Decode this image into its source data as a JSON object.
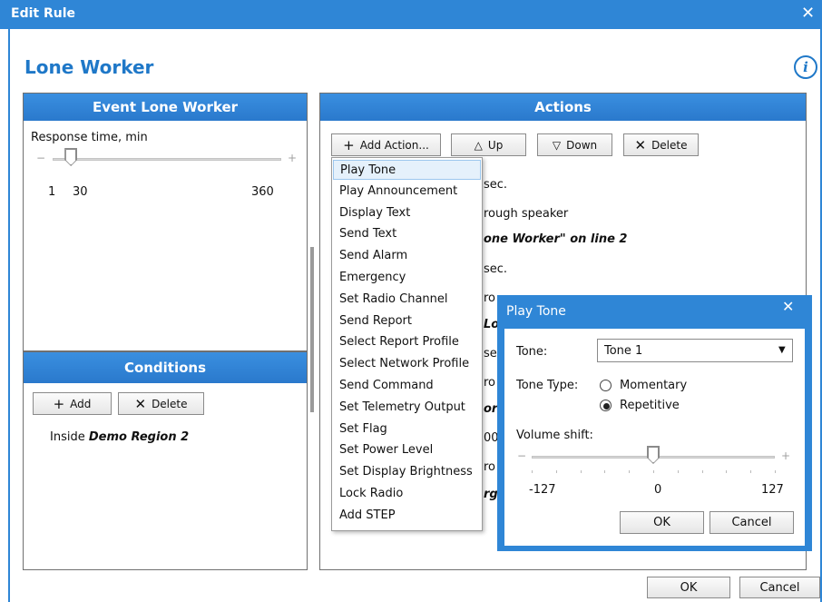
{
  "window": {
    "title": "Edit Rule",
    "close_glyph": "✕"
  },
  "rule": {
    "title": "Lone Worker",
    "info_glyph": "i"
  },
  "event_panel": {
    "header": "Event  Lone Worker",
    "label": "Response time, min",
    "min": "1",
    "value": "30",
    "max": "360",
    "minus": "−",
    "plus": "+",
    "level_fraction": 0.08
  },
  "conditions_panel": {
    "header": "Conditions",
    "add_label": "Add",
    "delete_label": "Delete",
    "item_prefix": "Inside ",
    "item_region": "Demo Region 2"
  },
  "actions_panel": {
    "header": "Actions",
    "add_action_label": "Add Action...",
    "up_label": "Up",
    "down_label": "Down",
    "delete_label": "Delete",
    "visible_fragments": [
      "sec.",
      "rough speaker",
      "one Worker\" on line 2",
      "sec.",
      "ro",
      "Lo",
      "se",
      "ro",
      "ork",
      "00",
      "ro",
      "rg"
    ]
  },
  "add_action_menu": {
    "items": [
      "Play Tone",
      "Play Announcement",
      "Display Text",
      "Send Text",
      "Send Alarm",
      "Emergency",
      "Set Radio Channel",
      "Send Report",
      "Select Report Profile",
      "Select Network Profile",
      "Send Command",
      "Set Telemetry Output",
      "Set Flag",
      "Set Power Level",
      "Set Display Brightness",
      "Lock Radio",
      "Add STEP"
    ],
    "selected_index": 0
  },
  "play_tone": {
    "title": "Play Tone",
    "close_glyph": "✕",
    "tone_label": "Tone:",
    "tone_value": "Tone 1",
    "tone_type_label": "Tone Type:",
    "momentary_label": "Momentary",
    "repetitive_label": "Repetitive",
    "selected_type": "Repetitive",
    "volume_label": "Volume shift:",
    "min": "-127",
    "value": "0",
    "max": "127",
    "minus": "−",
    "plus": "+",
    "level_fraction": 0.5,
    "ok_label": "OK",
    "cancel_label": "Cancel"
  },
  "footer": {
    "ok_label": "OK",
    "cancel_label": "Cancel"
  },
  "icons": {
    "add": "+",
    "up": "△",
    "down": "▽",
    "delete": "✕",
    "dropdown": "▼"
  },
  "colors": {
    "accent": "#2f86d6",
    "header_blue": "#3a8fe0",
    "selection": "#e5f1fb"
  }
}
